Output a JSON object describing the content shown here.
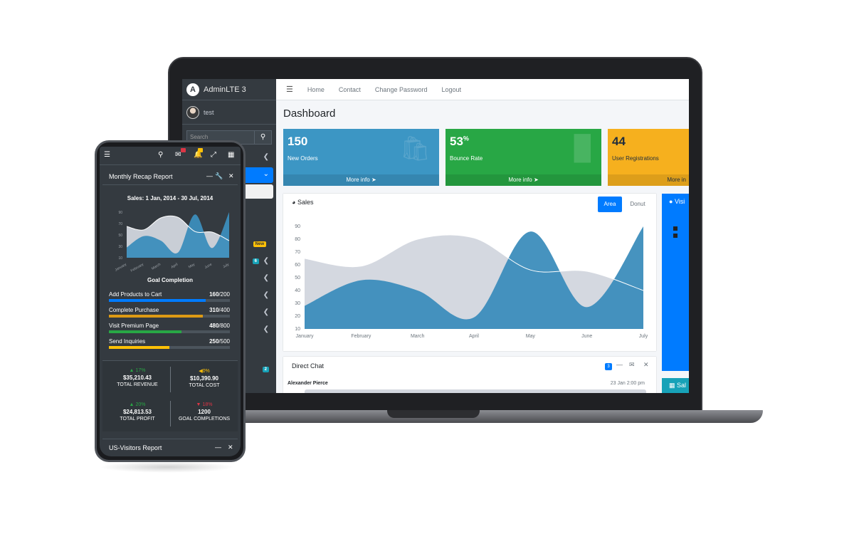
{
  "laptop": {
    "brand": "AdminLTE 3",
    "user": "test",
    "search_placeholder": "Search",
    "sidebar_badges": {
      "new": "New",
      "count6": "6",
      "count2": "2"
    },
    "topnav": [
      "Home",
      "Contact",
      "Change Password",
      "Logout"
    ],
    "page_title": "Dashboard",
    "boxes": [
      {
        "value": "150",
        "sup": "",
        "label": "New Orders",
        "footer": "More info",
        "color": "#3c96c4"
      },
      {
        "value": "53",
        "sup": "%",
        "label": "Bounce Rate",
        "footer": "More info",
        "color": "#28a745"
      },
      {
        "value": "44",
        "sup": "",
        "label": "User Registrations",
        "footer": "More in",
        "color": "#f6b01e"
      }
    ],
    "sales": {
      "title": "Sales",
      "tab_area": "Area",
      "tab_donut": "Donut"
    },
    "visitors_title": "Visi",
    "sales2_title": "Sal",
    "chat": {
      "title": "Direct Chat",
      "badge": "3",
      "author": "Alexander Pierce",
      "time": "23 Jan 2:00 pm"
    }
  },
  "phone": {
    "card_title": "Monthly Recap Report",
    "chart_title": "Sales: 1 Jan, 2014 - 30 Jul, 2014",
    "goal_title": "Goal Completion",
    "goals": [
      {
        "label": "Add Products to Cart",
        "value": "160",
        "total": "/200",
        "fraction": 0.8,
        "color": "#007bff"
      },
      {
        "label": "Complete Purchase",
        "value": "310",
        "total": "/400",
        "fraction": 0.775,
        "color": "#dc9a14"
      },
      {
        "label": "Visit Premium Page",
        "value": "480",
        "total": "/800",
        "fraction": 0.6,
        "color": "#28a745"
      },
      {
        "label": "Send Inquiries",
        "value": "250",
        "total": "/500",
        "fraction": 0.5,
        "color": "#ffc107"
      }
    ],
    "stats": [
      {
        "delta": "17%",
        "value": "$35,210.43",
        "label": "TOTAL REVENUE",
        "color": "#28a745",
        "arrow": "▲"
      },
      {
        "delta": "0%",
        "value": "$10,390.90",
        "label": "TOTAL COST",
        "color": "#ffc107",
        "arrow": "◀"
      },
      {
        "delta": "20%",
        "value": "$24,813.53",
        "label": "TOTAL PROFIT",
        "color": "#28a745",
        "arrow": "▲"
      },
      {
        "delta": "18%",
        "value": "1200",
        "label": "GOAL COMPLETIONS",
        "color": "#dc3545",
        "arrow": "▼"
      }
    ],
    "report2_title": "US-Visitors Report"
  },
  "chart_data": {
    "type": "area",
    "title": "Sales",
    "categories": [
      "January",
      "February",
      "March",
      "April",
      "May",
      "June",
      "July"
    ],
    "yticks": [
      10,
      20,
      30,
      40,
      50,
      60,
      70,
      80,
      90
    ],
    "ylim": [
      10,
      90
    ],
    "series": [
      {
        "values": [
          65,
          59,
          80,
          81,
          56,
          55,
          40
        ],
        "color": "#d2d6de"
      },
      {
        "values": [
          28,
          48,
          40,
          19,
          86,
          27,
          90
        ],
        "color": "#3c8dbc"
      }
    ],
    "grid": false,
    "legend": "none"
  },
  "colors": {
    "primary": "#007bff",
    "sidebar": "#343a40",
    "area_dark": "#3c8dbc",
    "area_light": "#d2d6de"
  }
}
